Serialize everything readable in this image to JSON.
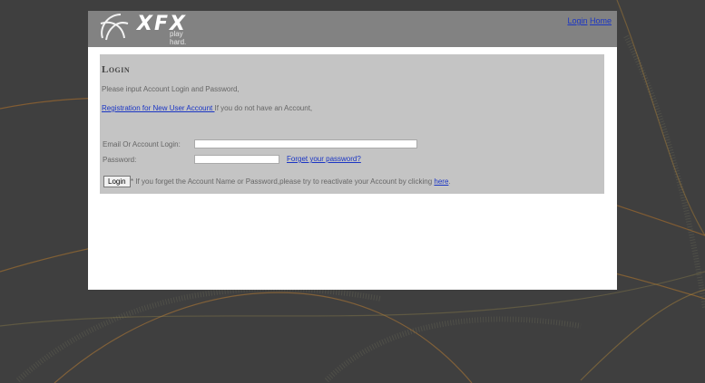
{
  "header": {
    "logo_text": "XFX",
    "tagline": "play hard.",
    "links": [
      "Login",
      "Home"
    ]
  },
  "login": {
    "title": "Login",
    "intro": "Please input Account Login and Password,",
    "register_link": "Registration for New User Account ",
    "register_suffix": "If you do not have an Account,",
    "email_label": "Email Or Account Login:",
    "email_value": "",
    "password_label": "Password:",
    "password_value": "",
    "forgot_link": "Forget your password?",
    "login_button": "Login",
    "note_text": "* If you forget the Account Name or Password,please try to reactivate your Account by clicking ",
    "note_link": "here",
    "note_end": "."
  },
  "colors": {
    "page_bg": "#3f3f3f",
    "header_bg": "#828282",
    "panel_bg": "#c4c4c4",
    "link": "#1a35c4"
  }
}
